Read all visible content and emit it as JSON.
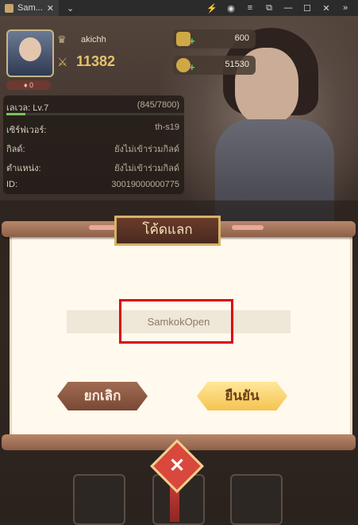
{
  "window": {
    "tab_title": "Sam..."
  },
  "player": {
    "nickname": "akichh",
    "power": "11382",
    "vip_badge": "0"
  },
  "resources": [
    {
      "value": "600"
    },
    {
      "value": "51530"
    }
  ],
  "info": {
    "rows": [
      {
        "label": "เลเวล: Lv.7",
        "value": "(845/7800)"
      },
      {
        "label": "เซิร์ฟเวอร์:",
        "value": "th-s19"
      },
      {
        "label": "กิลด์:",
        "value": "ยังไม่เข้าร่วมกิลด์"
      },
      {
        "label": "ตำแหน่ง:",
        "value": "ยังไม่เข้าร่วมกิลด์"
      },
      {
        "label": "ID:",
        "value": "30019000000775"
      }
    ],
    "xp_fraction": 0.108
  },
  "dialog": {
    "title": "โค้ดแลก",
    "code_value": "SamkokOpen",
    "cancel_label": "ยกเลิก",
    "confirm_label": "ยืนยัน"
  },
  "colors": {
    "highlight": "#e00000",
    "confirm": "#f4c451",
    "cancel": "#7a4835"
  }
}
